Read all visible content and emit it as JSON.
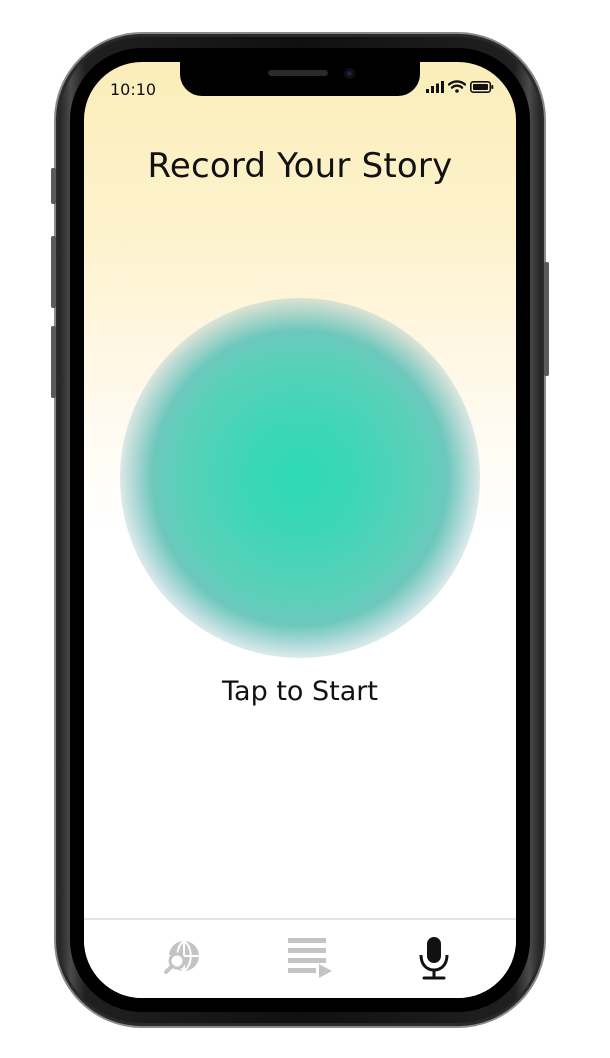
{
  "status_bar": {
    "time": "10:10",
    "icons": [
      "signal-icon",
      "wifi-icon",
      "battery-icon"
    ]
  },
  "screen": {
    "title": "Record Your Story",
    "record_hint": "Tap to Start"
  },
  "tab_bar": {
    "items": [
      {
        "name": "explore",
        "icon": "globe-search-icon",
        "active": false
      },
      {
        "name": "playlist",
        "icon": "playlist-icon",
        "active": false
      },
      {
        "name": "record",
        "icon": "microphone-icon",
        "active": true
      }
    ]
  },
  "colors": {
    "background_top": "#fbeebb",
    "orb_center": "#2ddab7",
    "orb_edge": "#6dc8bc",
    "tab_active": "#111111",
    "tab_inactive": "#c4c4c4"
  }
}
